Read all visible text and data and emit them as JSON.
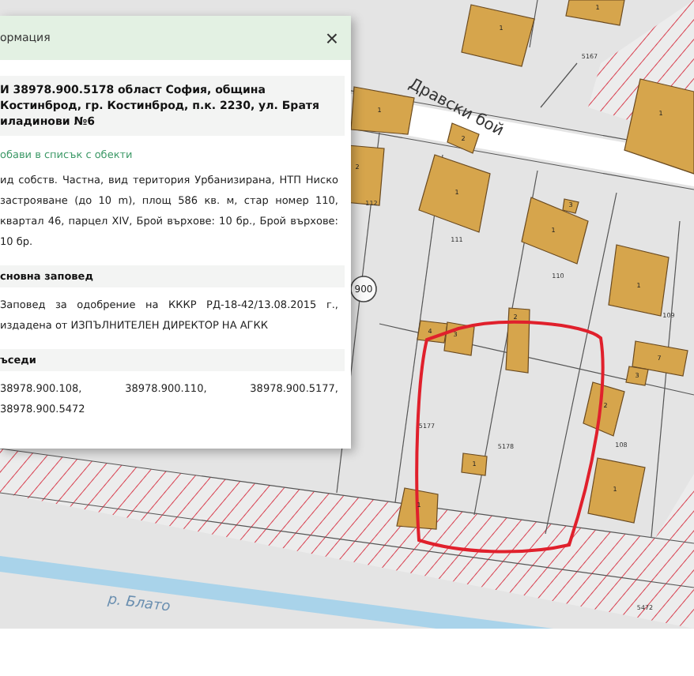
{
  "popup": {
    "title": "ормация",
    "close": "×",
    "address": "И 38978.900.5178 област София, община Костинброд, гр. Костинброд, п.к. 2230, ул. Братя иладинови №6",
    "add_link": "обави в списък с обекти",
    "description": "ид собств. Частна, вид територия Урбанизирана, НТП Ниско застрояване (до 10 m), площ 586 кв. м, стар номер 110, квартал 46, парцел XIV, Брой върхове: 10 бр., Брой върхове: 10 бр.",
    "sections": [
      {
        "heading": "сновна заповед",
        "text": "Заповед за одобрение на КККР РД-18-42/13.08.2015 г., издадена от ИЗПЪЛНИТЕЛЕН ДИРЕКТОР НА АГКК"
      },
      {
        "heading": "ъседи",
        "text": "38978.900.108, 38978.900.110, 38978.900.5177, 38978.900.5472"
      }
    ]
  },
  "map": {
    "street_label": "Дравски бой",
    "river_label": "р. Блато",
    "circle_label": "900",
    "parcel_labels": [
      "5167",
      "112",
      "111",
      "110",
      "109",
      "5177",
      "5178",
      "108",
      "5472"
    ],
    "building_labels": [
      "1",
      "1",
      "1",
      "1",
      "2",
      "2",
      "1",
      "1",
      "3",
      "1",
      "2",
      "4",
      "3",
      "7",
      "3",
      "2",
      "1",
      "1",
      "1"
    ]
  }
}
